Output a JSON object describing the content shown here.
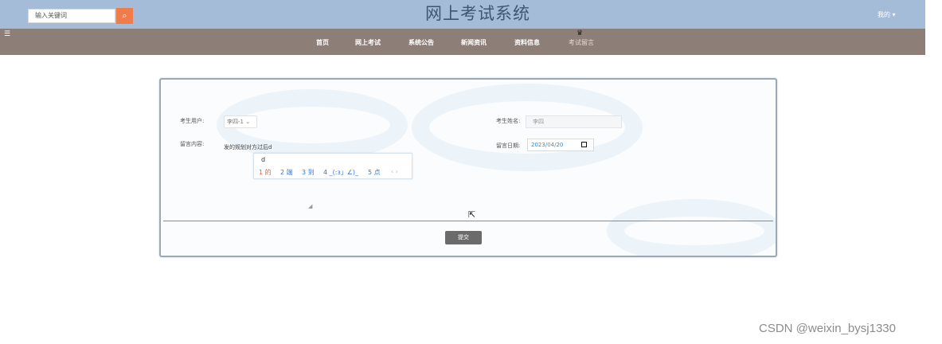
{
  "header": {
    "search_placeholder": "输入关键词",
    "search_icon": "search-icon",
    "title": "网上考试系统",
    "user_menu": "我的 ▾"
  },
  "nav": {
    "menu_icon": "☰",
    "items": [
      "首页",
      "网上考试",
      "系统公告",
      "新闻资讯",
      "资料信息",
      "考试留言"
    ],
    "active_index": 5,
    "active_icon": "crown-icon"
  },
  "form": {
    "user_label": "考生用户:",
    "user_value": "李四-1 ⌄",
    "name_label": "考生姓名:",
    "name_value": "李四",
    "message_label": "留言内容:",
    "message_value": "发的规划对方过后d",
    "date_label": "留言日期:",
    "date_year": "2023/",
    "date_month": "04",
    "date_day": "/20",
    "submit_label": "提交"
  },
  "ime": {
    "compose": "d",
    "candidates": [
      "1 的",
      "2 端",
      "3 到",
      "4 _(:з」∠)_",
      "5 点",
      "‹ ›"
    ]
  },
  "watermark": "CSDN @weixin_bysj1330"
}
